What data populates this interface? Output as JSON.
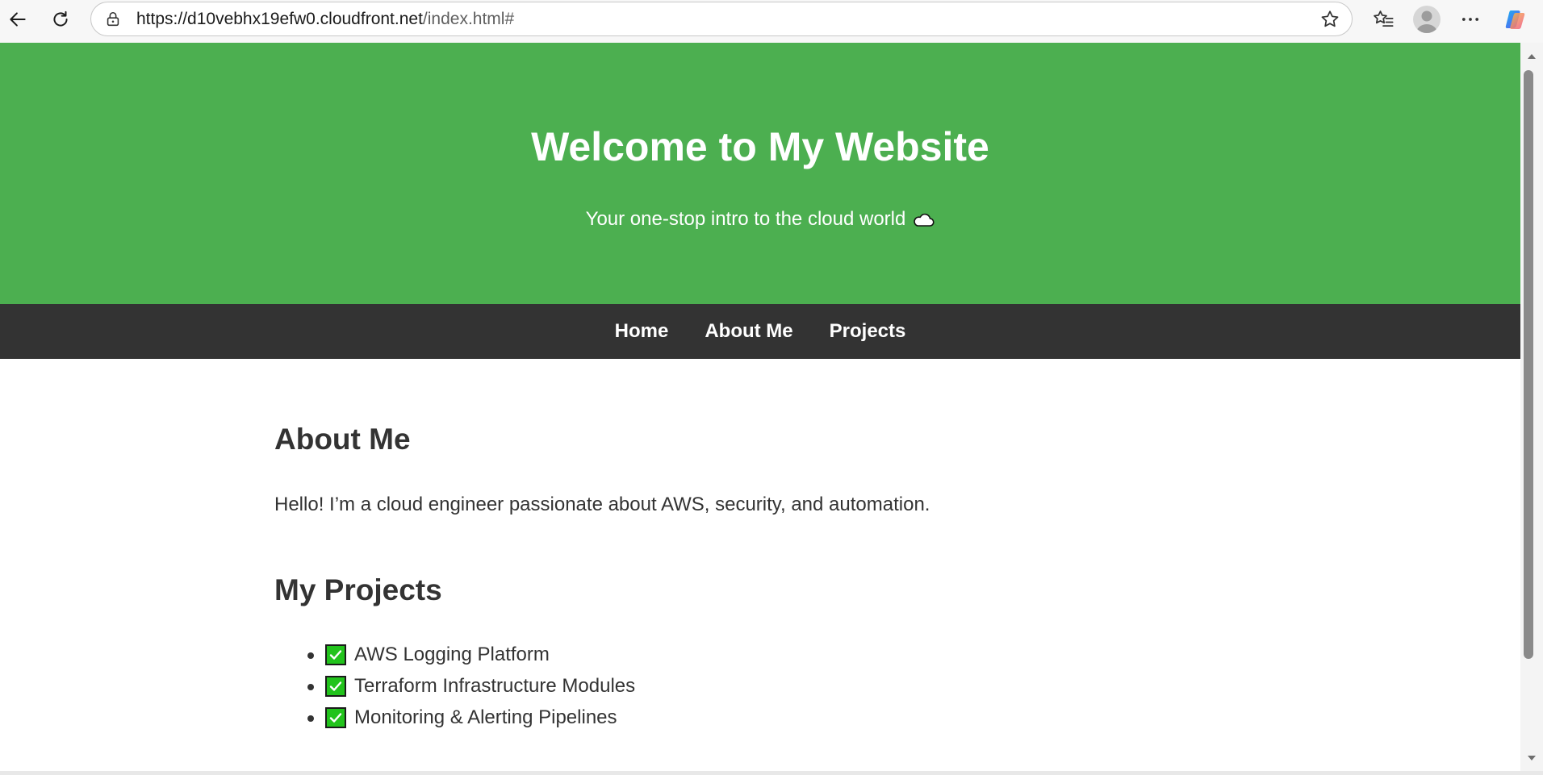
{
  "browser": {
    "url_host": "https://d10vebhx19efw0.cloudfront.net",
    "url_path": "/index.html#",
    "icons": {
      "back": "back-arrow-icon",
      "reload": "reload-icon",
      "lock": "lock-icon",
      "favorite": "star-icon",
      "favorites_list": "favorites-icon",
      "profile": "avatar-icon",
      "menu": "more-options-icon",
      "copilot": "copilot-icon"
    }
  },
  "hero": {
    "title": "Welcome to My Website",
    "subtitle": "Your one-stop intro to the cloud world",
    "subtitle_emoji": "cloud-icon",
    "background": "#4caf50"
  },
  "nav": {
    "items": [
      {
        "label": "Home"
      },
      {
        "label": "About Me"
      },
      {
        "label": "Projects"
      }
    ],
    "background": "#333333"
  },
  "about": {
    "heading": "About Me",
    "text": "Hello! I’m a cloud engineer passionate about AWS, security, and automation."
  },
  "projects": {
    "heading": "My Projects",
    "items": [
      {
        "label": "AWS Logging Platform"
      },
      {
        "label": "Terraform Infrastructure Modules"
      },
      {
        "label": "Monitoring & Alerting Pipelines"
      }
    ]
  }
}
